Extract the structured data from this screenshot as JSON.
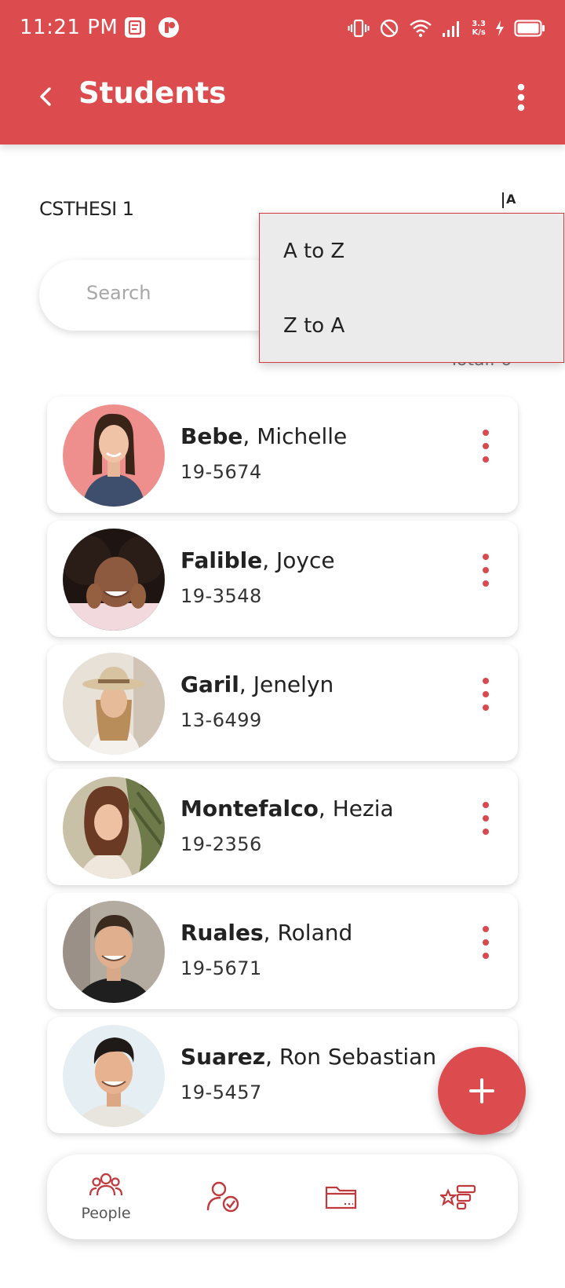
{
  "colors": {
    "primary": "#dc4c4f",
    "menu_background": "#ebebeb",
    "menu_border": "#d23a3f"
  },
  "status_bar": {
    "time": "11:21 PM",
    "net_speed_value": "3.3",
    "net_speed_unit": "K/s",
    "icons": [
      "notes-app-icon",
      "app-badge-icon",
      "vibrate-icon",
      "do-not-disturb-icon",
      "wifi-icon",
      "signal-icon",
      "charging-icon",
      "battery-icon"
    ]
  },
  "toolbar": {
    "title": "Students"
  },
  "section": {
    "title": "CSTHESI 1",
    "sort_toggle": "A",
    "total_label": "Total: 6"
  },
  "search": {
    "placeholder": "Search"
  },
  "sort_menu": {
    "options": [
      "A to Z",
      "Z to A"
    ]
  },
  "students": [
    {
      "last_name": "Bebe",
      "first_name": "Michelle",
      "id": "19-5674"
    },
    {
      "last_name": "Falible",
      "first_name": "Joyce",
      "id": "19-3548"
    },
    {
      "last_name": "Garil",
      "first_name": "Jenelyn",
      "id": "13-6499"
    },
    {
      "last_name": "Montefalco",
      "first_name": "Hezia",
      "id": "19-2356"
    },
    {
      "last_name": "Ruales",
      "first_name": "Roland",
      "id": "19-5671"
    },
    {
      "last_name": "Suarez",
      "first_name": "Ron Sebastian",
      "id": "19-5457"
    }
  ],
  "name_separator": ", ",
  "bottom_nav": {
    "people_label": "People",
    "icons": [
      "people-icon",
      "user-check-icon",
      "folder-icon",
      "ranking-icon"
    ]
  }
}
